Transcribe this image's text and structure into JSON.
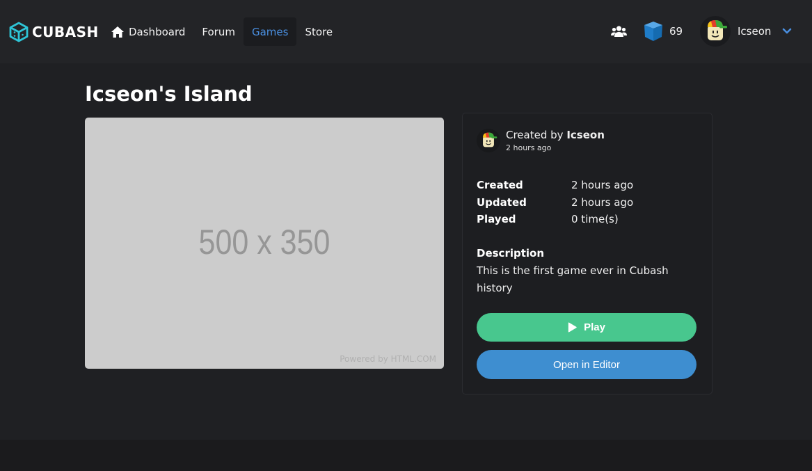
{
  "navbar": {
    "brand": "CUBASH",
    "links": [
      {
        "label": "Dashboard",
        "icon": "home-icon"
      },
      {
        "label": "Forum"
      },
      {
        "label": "Games",
        "active": true
      },
      {
        "label": "Store"
      }
    ],
    "currency_amount": "69",
    "username": "Icseon"
  },
  "game": {
    "title": "Icseon's Island",
    "thumbnail_text": "500 x 350",
    "thumbnail_powered": "Powered by HTML.COM",
    "creator_prefix": "Created by",
    "creator_name": "Icseon",
    "creator_time": "2 hours ago",
    "stats": [
      {
        "label": "Created",
        "value": "2 hours ago"
      },
      {
        "label": "Updated",
        "value": "2 hours ago"
      },
      {
        "label": "Played",
        "value": "0 time(s)"
      }
    ],
    "description_label": "Description",
    "description": "This is the first game ever in Cubash history",
    "play_label": "Play",
    "editor_label": "Open in Editor"
  },
  "colors": {
    "background": "#1f2023",
    "navbar": "#232427",
    "accent_blue": "#3e8ed0",
    "play_green": "#48c78e",
    "brand_cyan": "#2ec4d6"
  }
}
